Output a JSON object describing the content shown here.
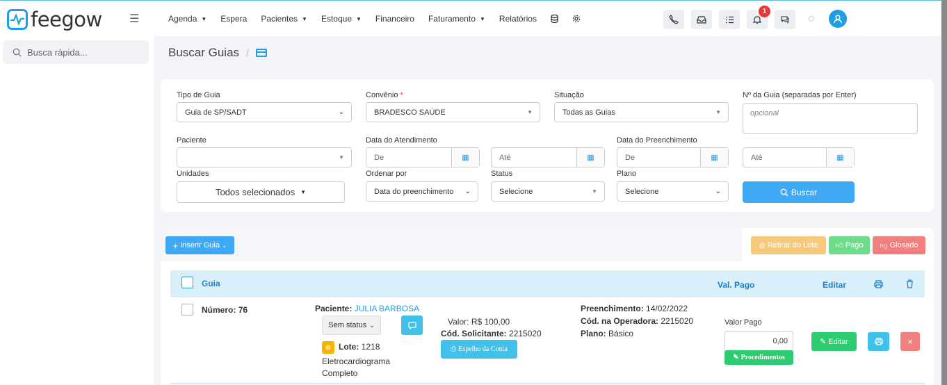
{
  "brand": {
    "name": "feegow",
    "accent": "#1e9fe5"
  },
  "nav": {
    "menu_icon": "hamburger-icon",
    "items": [
      {
        "label": "Agenda",
        "dropdown": true
      },
      {
        "label": "Espera",
        "dropdown": false
      },
      {
        "label": "Pacientes",
        "dropdown": true
      },
      {
        "label": "Estoque",
        "dropdown": true
      },
      {
        "label": "Financeiro",
        "dropdown": false
      },
      {
        "label": "Faturamento",
        "dropdown": true
      },
      {
        "label": "Relatórios",
        "dropdown": false
      }
    ],
    "icons": [
      "database-icon",
      "gear-icon"
    ],
    "tools": [
      "phone-icon",
      "inbox-icon",
      "tasks-icon",
      "bell-icon",
      "chat-icon"
    ],
    "notification_count": "1"
  },
  "sidebar": {
    "search_placeholder": "Busca rápida..."
  },
  "breadcrumb": {
    "title": "Buscar Guias",
    "separator": "/"
  },
  "filters": {
    "tipo_guia": {
      "label": "Tipo de Guia",
      "value": "Guia de SP/SADT"
    },
    "convenio": {
      "label": "Convênio",
      "required": "*",
      "value": "BRADESCO SAÚDE"
    },
    "situacao": {
      "label": "Situação",
      "value": "Todas as Guias"
    },
    "num_guia": {
      "label": "Nº da Guia (separadas por Enter)",
      "placeholder": "opcional"
    },
    "paciente": {
      "label": "Paciente",
      "value": ""
    },
    "data_atendimento": {
      "label": "Data do Atendimento",
      "de": "De",
      "ate": "Até"
    },
    "data_preenchimento": {
      "label": "Data do Preenchimento",
      "de": "De",
      "ate": "Até"
    },
    "unidades": {
      "label": "Unidades",
      "value": "Todos selecionados"
    },
    "ordenar": {
      "label": "Ordenar por",
      "value": "Data do preenchimento"
    },
    "status": {
      "label": "Status",
      "value": "Selecione"
    },
    "plano": {
      "label": "Plano",
      "value": "Selecione"
    },
    "buscar_label": "Buscar"
  },
  "actions": {
    "inserir": "Inserir Guia",
    "retirar": "Retirar do Lote",
    "pago": "Pago",
    "glosado": "Glosado",
    "colors": {
      "retirar": "#f7c97a",
      "pago": "#6fdc8c",
      "glosado": "#f08080",
      "inserir": "#3fa9f5"
    }
  },
  "table": {
    "headers": {
      "guia": "Guia",
      "val_pago": "Val. Pago",
      "editar": "Editar"
    },
    "row": {
      "numero_label": "Número:",
      "numero": "76",
      "paciente_label": "Paciente:",
      "paciente": "JULIA BARBOSA",
      "status": "Sem status",
      "lote_label": "Lote:",
      "lote": "1218",
      "procedimento_line1": "Eletrocardiograma",
      "procedimento_line2": "Completo",
      "valor_label": "Valor:",
      "valor": "R$ 100,00",
      "cod_solicitante_label": "Cód. Solicitante:",
      "cod_solicitante": "2215020",
      "espelho": "Espelho da Conta",
      "preenchimento_label": "Preenchimento:",
      "preenchimento": "14/02/2022",
      "cod_operadora_label": "Cód. na Operadora:",
      "cod_operadora": "2215020",
      "plano_label": "Plano:",
      "plano": "Básico",
      "valor_pago_label": "Valor Pago",
      "valor_pago": "0,00",
      "procedimentos": "Procedimentos",
      "editar": "Editar"
    }
  }
}
